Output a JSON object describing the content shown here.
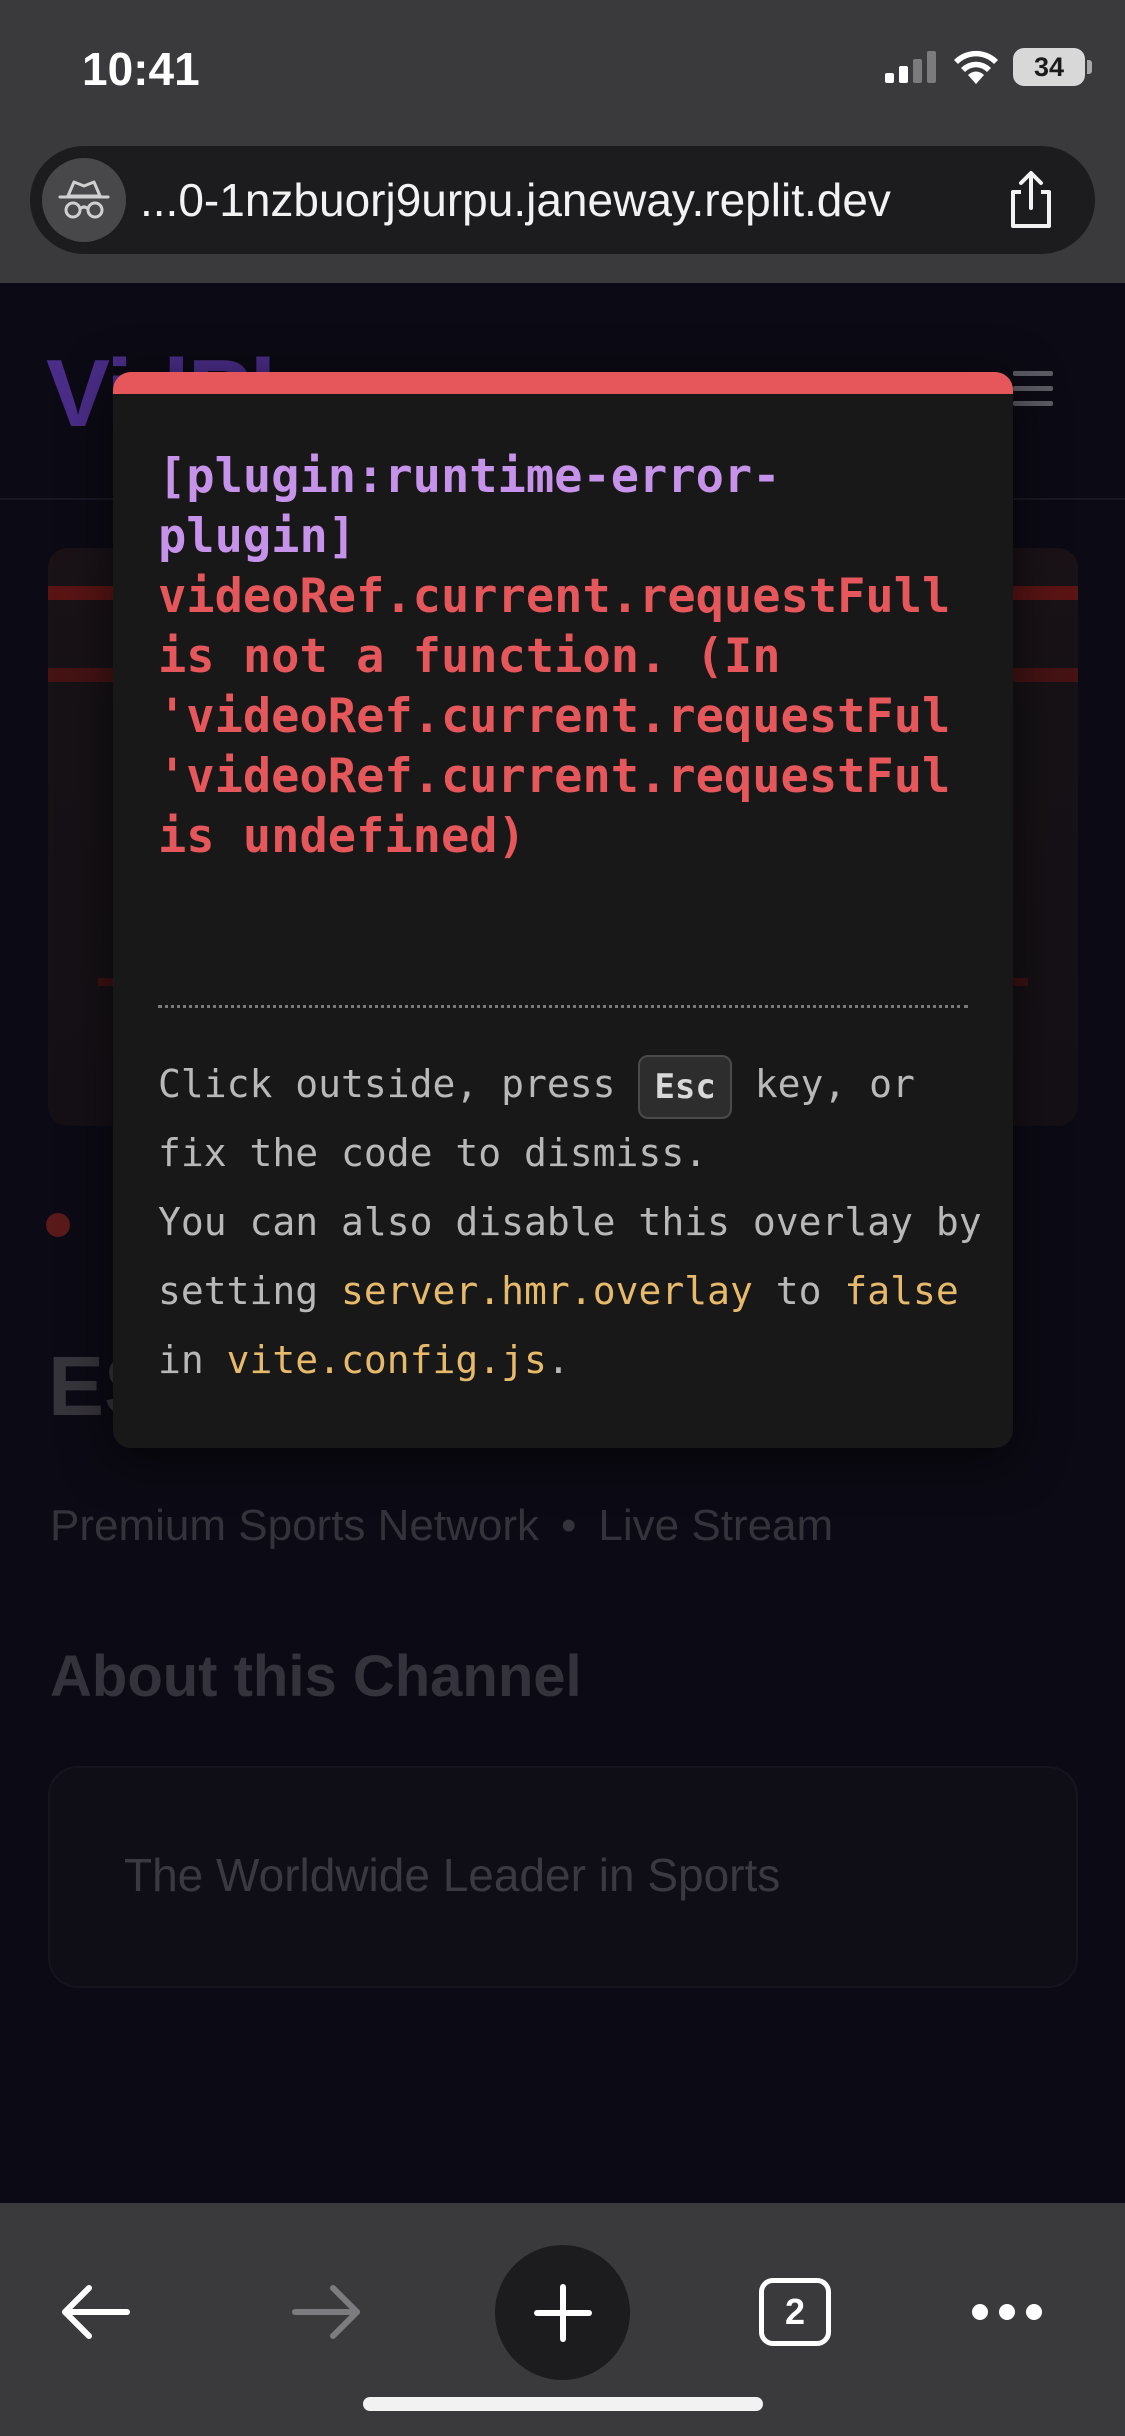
{
  "status_bar": {
    "time": "10:41",
    "battery": "34"
  },
  "browser": {
    "url": "...0-1nzbuorj9urpu.janeway.replit.dev"
  },
  "page": {
    "logo": "VidPl",
    "channel_name": "ESPN",
    "channel_meta": [
      "Premium Sports Network",
      "•",
      "Live Stream"
    ],
    "about_title": "About this Channel",
    "about_text": "The Worldwide Leader in Sports"
  },
  "error_overlay": {
    "plugin": "[plugin:runtime-error-\nplugin]",
    "message": "videoRef.current.requestFull\nis not a function. (In\n'videoRef.current.requestFul\n'videoRef.current.requestFul\nis undefined)",
    "tip_part1": "Click outside, press ",
    "tip_key": "Esc",
    "tip_part2": " key, or fix the code to dismiss.",
    "tip_part3": "You can also disable this overlay by setting ",
    "tip_setting": "server.hmr.overlay",
    "tip_part4": " to ",
    "tip_false": "false",
    "tip_part5": " in ",
    "tip_file": "vite.config.js",
    "tip_part6": "."
  },
  "toolbar": {
    "tab_count": "2"
  },
  "icons": {
    "privacy": "incognito-icon",
    "share": "share-icon",
    "back": "arrow-left-icon",
    "forward": "arrow-right-icon",
    "new_tab": "plus-icon",
    "tabs": "tabs-icon",
    "more": "ellipsis-icon"
  }
}
